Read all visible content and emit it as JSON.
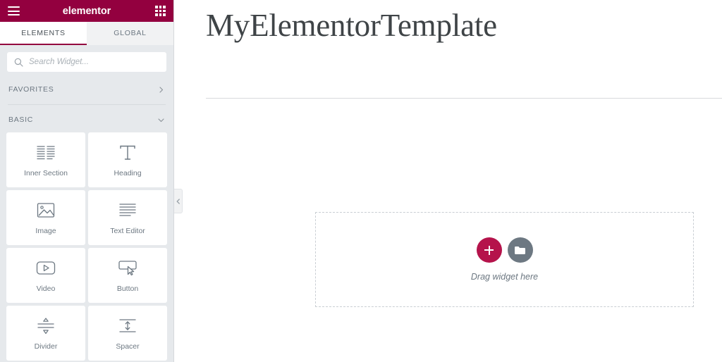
{
  "panel": {
    "brand_color": "#93003f",
    "title": "elementor",
    "menu_icon": "hamburger-icon",
    "apps_icon": "apps-grid-icon",
    "tabs": [
      {
        "label": "ELEMENTS",
        "active": true
      },
      {
        "label": "GLOBAL",
        "active": false
      }
    ],
    "search": {
      "placeholder": "Search Widget...",
      "value": "",
      "icon": "search-icon"
    },
    "categories": [
      {
        "label": "FAVORITES",
        "expanded": false,
        "chevron": "chevron-right-icon"
      },
      {
        "label": "BASIC",
        "expanded": true,
        "chevron": "chevron-down-icon"
      }
    ],
    "widgets": [
      {
        "label": "Inner Section",
        "icon": "inner-section-icon"
      },
      {
        "label": "Heading",
        "icon": "heading-icon"
      },
      {
        "label": "Image",
        "icon": "image-icon"
      },
      {
        "label": "Text Editor",
        "icon": "text-editor-icon"
      },
      {
        "label": "Video",
        "icon": "video-icon"
      },
      {
        "label": "Button",
        "icon": "button-icon"
      },
      {
        "label": "Divider",
        "icon": "divider-icon"
      },
      {
        "label": "Spacer",
        "icon": "spacer-icon"
      }
    ],
    "collapse_handle_icon": "chevron-left-icon"
  },
  "canvas": {
    "title": "MyElementorTemplate",
    "dropzone": {
      "add_button_icon": "plus-icon",
      "add_button_color": "#b5134b",
      "folder_button_icon": "folder-icon",
      "folder_button_color": "#6d7882",
      "hint": "Drag widget here"
    }
  }
}
